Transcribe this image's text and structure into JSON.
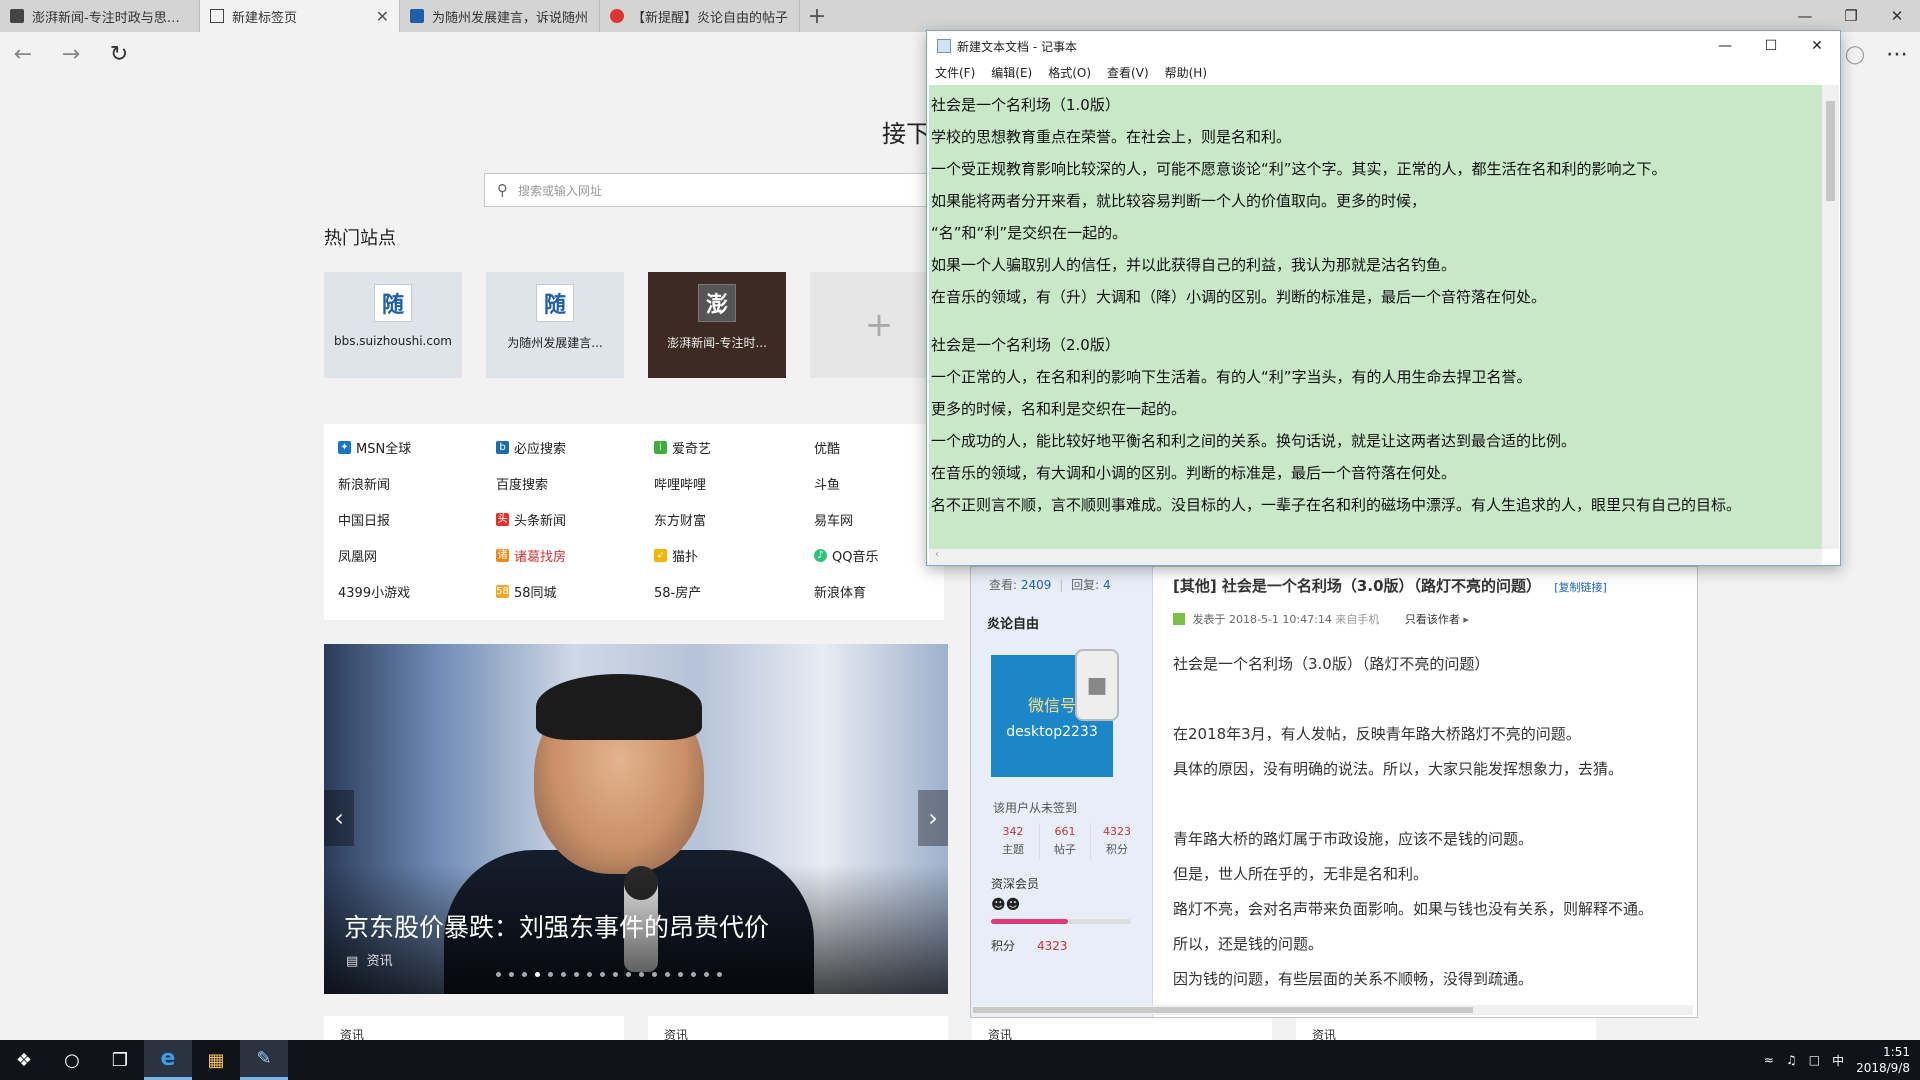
{
  "browser": {
    "tabs": [
      {
        "title": "澎湃新闻-专注时政与思想-1",
        "favicon": "pengpai-icon",
        "active": false
      },
      {
        "title": "新建标签页",
        "favicon": "page-icon",
        "active": true
      },
      {
        "title": "为随州发展建言，诉说随州",
        "favicon": "suizhou-icon",
        "active": false
      },
      {
        "title": "【新提醒】炎论自由的帖子",
        "favicon": "weibo-icon",
        "active": false
      }
    ],
    "new_tab_glyph": "+",
    "close_glyph": "✕"
  },
  "newtab": {
    "heading": "接下",
    "search_placeholder": "搜索或输入网址",
    "hot_sites_title": "热门站点",
    "tiles": [
      {
        "label": "bbs.suizhoushi.com",
        "logo": "随"
      },
      {
        "label": "为随州发展建言...",
        "logo": "随"
      },
      {
        "label": "澎湃新闻-专注时...",
        "logo": "澎"
      },
      {
        "label": "+"
      }
    ],
    "links": [
      [
        "MSN全球",
        "必应搜索",
        "爱奇艺",
        "优酷"
      ],
      [
        "新浪新闻",
        "百度搜索",
        "哔哩哔哩",
        "斗鱼"
      ],
      [
        "中国日报",
        "头条新闻",
        "东方财富",
        "易车网"
      ],
      [
        "凤凰网",
        "诸葛找房",
        "猫扑",
        "QQ音乐"
      ],
      [
        "4399小游戏",
        "58同城",
        "58-房产",
        "新浪体育"
      ]
    ],
    "carousel_title": "京东股价暴跌：刘强东事件的昂贵代价",
    "carousel_tag": "资讯",
    "carousel_slides": 18,
    "carousel_active": 3,
    "cards": [
      "资讯",
      "资讯",
      "资讯",
      "资讯"
    ]
  },
  "forum": {
    "views_label": "查看:",
    "views": "2409",
    "sep": "|",
    "replies_label": "回复:",
    "replies": "4",
    "username": "炎论自由",
    "avatar_line1": "微信号",
    "avatar_line2": "desktop2233",
    "unsigned": "该用户从未签到",
    "stats": [
      {
        "value": "342",
        "label": "主题"
      },
      {
        "value": "661",
        "label": "帖子"
      },
      {
        "value": "4323",
        "label": "积分"
      }
    ],
    "rank": "资深会员",
    "level_fraction": 0.55,
    "points_label": "积分",
    "points": "4323",
    "post_title": "[其他] 社会是一个名利场（3.0版）（路灯不亮的问题）",
    "copy_link": "[复制链接]",
    "meta_posted": "发表于 2018-5-1 10:47:14",
    "meta_source": "来自手机",
    "meta_only": "只看该作者",
    "body": [
      "社会是一个名利场（3.0版）（路灯不亮的问题）",
      "",
      "在2018年3月，有人发帖，反映青年路大桥路灯不亮的问题。",
      "具体的原因，没有明确的说法。所以，大家只能发挥想象力，去猜。",
      "",
      "青年路大桥的路灯属于市政设施，应该不是钱的问题。",
      "但是，世人所在乎的，无非是名和利。",
      "路灯不亮，会对名声带来负面影响。如果与钱也没有关系，则解释不通。",
      "所以，还是钱的问题。",
      "因为钱的问题，有些层面的关系不顺畅，没得到疏通。"
    ]
  },
  "notepad": {
    "title": "新建文本文档 - 记事本",
    "menu": [
      "文件(F)",
      "编辑(E)",
      "格式(O)",
      "查看(V)",
      "帮助(H)"
    ],
    "lines": [
      "社会是一个名利场（1.0版）",
      "学校的思想教育重点在荣誉。在社会上，则是名和利。",
      "一个受正规教育影响比较深的人，可能不愿意谈论“利”这个字。其实，正常的人，都生活在名和利的影响之下。",
      "如果能将两者分开来看，就比较容易判断一个人的价值取向。更多的时候，",
      "“名”和“利”是交织在一起的。",
      "如果一个人骗取别人的信任，并以此获得自己的利益，我认为那就是沽名钓鱼。",
      "在音乐的领域，有（升）大调和（降）小调的区别。判断的标准是，最后一个音符落在何处。",
      "",
      "社会是一个名利场（2.0版）",
      "一个正常的人，在名和利的影响下生活着。有的人“利”字当头，有的人用生命去捍卫名誉。",
      "更多的时候，名和利是交织在一起的。",
      "一个成功的人，能比较好地平衡名和利之间的关系。换句话说，就是让这两者达到最合适的比例。",
      "在音乐的领域，有大调和小调的区别。判断的标准是，最后一个音符落在何处。",
      "名不正则言不顺，言不顺则事难成。没目标的人，一辈子在名和利的磁场中漂浮。有人生追求的人，眼里只有自己的目标。"
    ]
  },
  "taskbar": {
    "ime": "中",
    "time": "1:51",
    "date": "2018/9/8"
  },
  "colors": {
    "notepad_bg": "#c8e8c8",
    "tile_bg": "#dfe3ea",
    "forum_link": "#1f62b8"
  }
}
